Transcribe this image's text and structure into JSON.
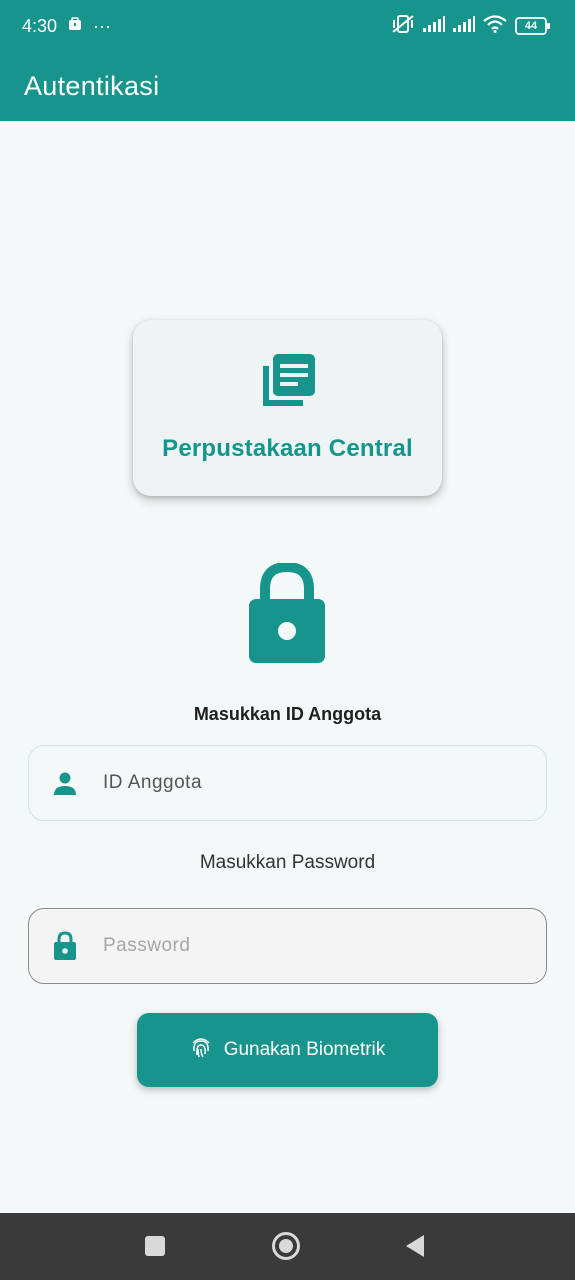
{
  "status_bar": {
    "time": "4:30",
    "more": "···",
    "battery": "44",
    "icons": [
      "briefcase-icon",
      "mute-vibrate-icon",
      "signal-icon",
      "signal-icon",
      "wifi-icon",
      "battery-icon"
    ]
  },
  "app_bar": {
    "title": "Autentikasi"
  },
  "brand": {
    "name": "Perpustakaan Central",
    "icon": "library-books-icon"
  },
  "form": {
    "id_label": "Masukkan ID Anggota",
    "id_placeholder": "ID Anggota",
    "password_label": "Masukkan Password",
    "password_placeholder": "Password"
  },
  "biometric_button": {
    "label": "Gunakan Biometrik",
    "icon": "fingerprint-icon"
  },
  "nav": {
    "items": [
      "recents-button",
      "home-button",
      "back-button"
    ]
  },
  "colors": {
    "primary": "#17958d",
    "background": "#f3f9f8",
    "nav_bar": "#3a3a3a"
  }
}
